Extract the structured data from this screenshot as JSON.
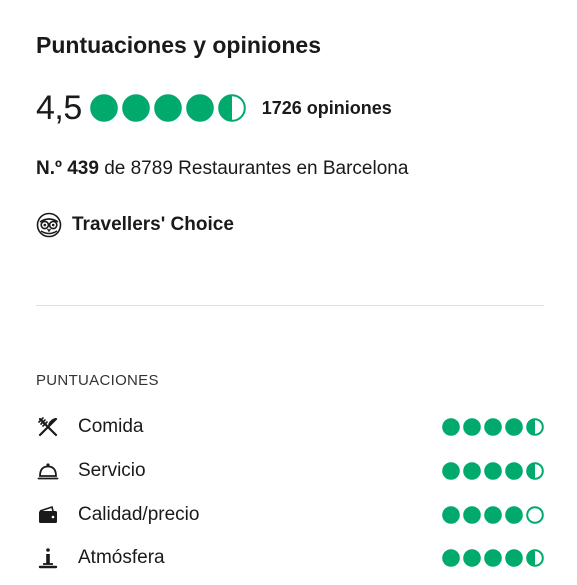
{
  "title": "Puntuaciones y opiniones",
  "overall": {
    "score": "4,5",
    "rating": 4.5,
    "review_count": "1726 opiniones"
  },
  "ranking": {
    "number": "N.º 439",
    "rest": " de 8789 Restaurantes en Barcelona"
  },
  "award": {
    "label": "Travellers' Choice",
    "icon": "owl-award-icon"
  },
  "ratings_section": {
    "label": "PUNTUACIONES",
    "items": [
      {
        "label": "Comida",
        "icon": "utensils-icon",
        "rating": 4.5
      },
      {
        "label": "Servicio",
        "icon": "cloche-icon",
        "rating": 4.5
      },
      {
        "label": "Calidad/precio",
        "icon": "wallet-icon",
        "rating": 4.0
      },
      {
        "label": "Atmósfera",
        "icon": "atmosphere-icon",
        "rating": 4.5
      }
    ]
  },
  "colors": {
    "bubble": "#00aa6c",
    "text": "#1a1a1a",
    "divider": "#e0e0e0"
  }
}
